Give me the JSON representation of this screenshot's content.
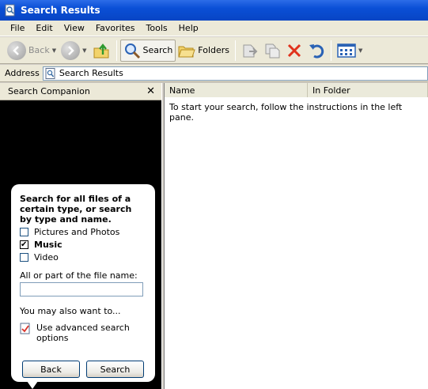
{
  "window": {
    "title": "Search Results"
  },
  "menu": [
    "File",
    "Edit",
    "View",
    "Favorites",
    "Tools",
    "Help"
  ],
  "toolbar": {
    "back_label": "Back",
    "search_label": "Search",
    "folders_label": "Folders"
  },
  "address": {
    "label": "Address",
    "value": "Search Results"
  },
  "left_pane": {
    "title": "Search Companion",
    "heading": "Search for all files of a certain type, or search by type and name.",
    "options": [
      {
        "label": "Pictures and Photos",
        "checked": false
      },
      {
        "label": "Music",
        "checked": true
      },
      {
        "label": "Video",
        "checked": false
      }
    ],
    "filename_label": "All or part of the file name:",
    "filename_value": "",
    "also_label": "You may also want to...",
    "advanced_label": "Use advanced search options",
    "back_button": "Back",
    "search_button": "Search"
  },
  "results": {
    "columns": [
      "Name",
      "In Folder"
    ],
    "message": "To start your search, follow the instructions in the left pane."
  }
}
